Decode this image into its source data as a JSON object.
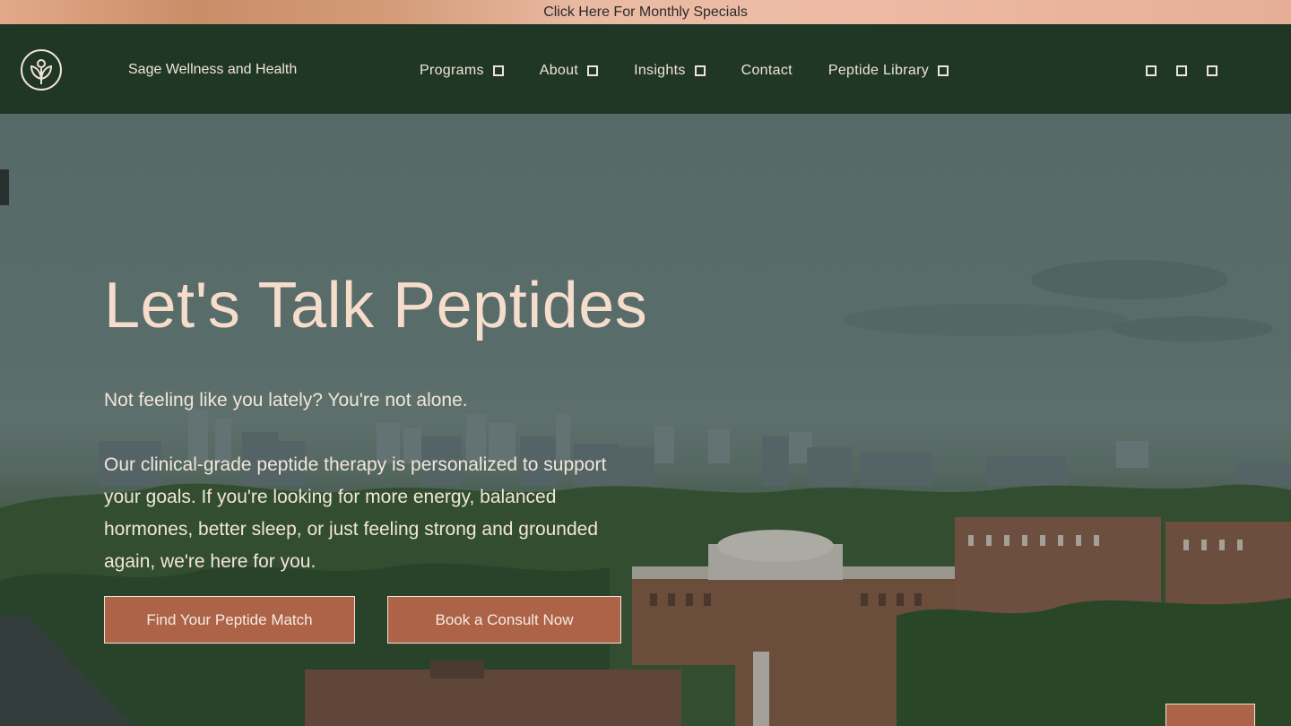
{
  "announcement": {
    "text": "Click Here For Monthly Specials"
  },
  "header": {
    "brand_name": "Sage Wellness and Health",
    "nav_items": [
      {
        "label": "Programs",
        "has_dropdown": true
      },
      {
        "label": "About",
        "has_dropdown": true
      },
      {
        "label": "Insights",
        "has_dropdown": true
      },
      {
        "label": "Contact",
        "has_dropdown": false
      },
      {
        "label": "Peptide Library",
        "has_dropdown": true
      }
    ],
    "utility_icons": [
      "search-icon",
      "account-icon",
      "cart-icon"
    ]
  },
  "hero": {
    "title": "Let's Talk Peptides",
    "subtitle": "Not feeling like you lately? You're not alone.",
    "body": "Our clinical-grade peptide therapy is personalized to support your goals. If you're looking for more energy, balanced hormones, better sleep, or just feeling strong and grounded again, we're here for you.",
    "primary_cta": "Find Your Peptide Match",
    "secondary_cta": "Book a Consult Now"
  },
  "colors": {
    "nav_bg": "#213726",
    "accent": "#ad6347",
    "heading": "#f6dccb",
    "text": "#f1e6d9"
  }
}
